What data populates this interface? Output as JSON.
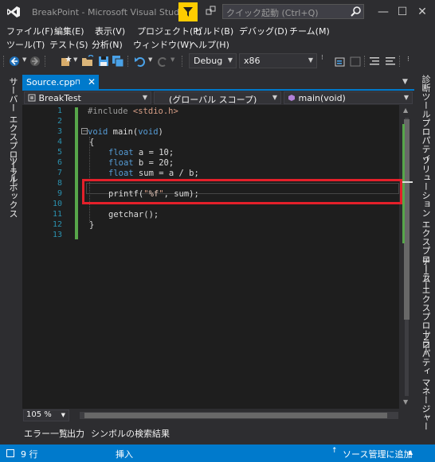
{
  "window": {
    "title": "BreakPoint - Microsoft Visual Studio",
    "quick_launch_placeholder": "クイック起動 (Ctrl+Q)"
  },
  "menu": {
    "row1": [
      "ファイル(F)",
      "編集(E)",
      "表示(V)",
      "プロジェクト(P)",
      "ビルド(B)",
      "デバッグ(D)",
      "チーム(M)"
    ],
    "row2": [
      "ツール(T)",
      "テスト(S)",
      "分析(N)",
      "ウィンドウ(W)",
      "ヘルプ(H)"
    ]
  },
  "toolbar": {
    "configuration": "Debug",
    "platform": "x86"
  },
  "left_panel": {
    "tabs": [
      "サーバー エクスプローラー",
      "ツールボックス"
    ]
  },
  "right_panel": {
    "tabs": [
      "診断ツール",
      "プロパティ",
      "ソリューション エクスプローラー",
      "チーム エクスプローラー",
      "プロパティ マネージャー"
    ]
  },
  "document": {
    "tab_label": "Source.cpp",
    "nav_project": "BreakTest",
    "nav_scope": "(グローバル スコープ)",
    "nav_member": "main(void)",
    "zoom": "105 %"
  },
  "code": {
    "line_numbers": [
      "1",
      "2",
      "3",
      "4",
      "5",
      "6",
      "7",
      "8",
      "9",
      "10",
      "11",
      "12",
      "13"
    ],
    "l1_directive": "#include ",
    "l1_header": "<stdio.h>",
    "l3_void1": "void",
    "l3_main": " main(",
    "l3_void2": "void",
    "l3_close": ")",
    "l4": "{",
    "l5_type": "float",
    "l5_rest": " a = 10;",
    "l6_type": "float",
    "l6_rest": " b = 20;",
    "l7_type": "float",
    "l7_rest": " sum = a / b;",
    "l9_func": "printf(",
    "l9_str_open": "\"",
    "l9_fmt": "%f",
    "l9_str_close": "\"",
    "l9_rest": ", sum);",
    "l11": "getchar();",
    "l12": "}"
  },
  "bottom_tabs": [
    "エラー一覧",
    "出力",
    "シンボルの検索結果"
  ],
  "status": {
    "line": "9 行",
    "mode": "挿入",
    "scm": "ソース管理に追加"
  },
  "colors": {
    "accent": "#007acc",
    "highlight_box": "#e4202a",
    "change_bar": "#57a64a",
    "keyword": "#569cd6",
    "line_number": "#2b91af"
  }
}
